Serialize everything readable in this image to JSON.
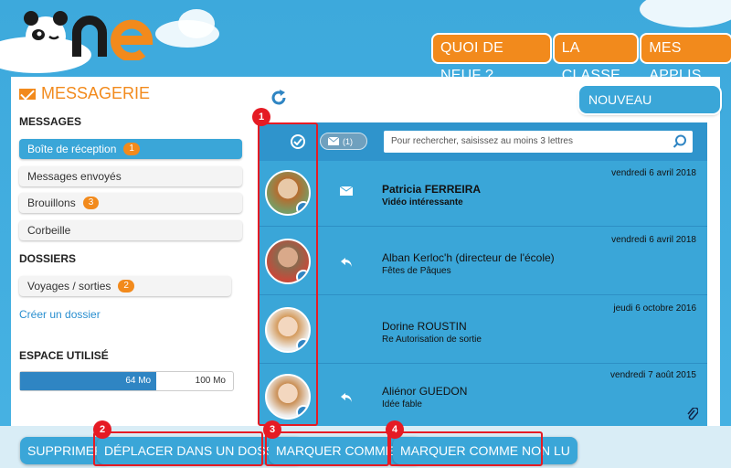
{
  "app": {
    "logo_text": "One"
  },
  "top_nav": [
    "QUOI DE NEUF ?",
    "LA CLASSE",
    "MES APPLIS"
  ],
  "page_title": "MESSAGERIE",
  "new_message_label": "NOUVEAU MESSAGE",
  "sidebar": {
    "messages_heading": "MESSAGES",
    "folders": [
      {
        "label": "Boîte de réception",
        "count": "1",
        "active": true
      },
      {
        "label": "Messages envoyés",
        "count": ""
      },
      {
        "label": "Brouillons",
        "count": "3"
      },
      {
        "label": "Corbeille",
        "count": ""
      }
    ],
    "dossiers_heading": "DOSSIERS",
    "dossiers": [
      {
        "label": "Voyages / sorties",
        "count": "2"
      }
    ],
    "create_folder_link": "Créer un dossier",
    "space_heading": "ESPACE UTILISÉ",
    "space_used": "64 Mo",
    "space_total": "100 Mo",
    "space_ratio": 0.64
  },
  "list_header": {
    "unread_count": "(1)",
    "search_placeholder": "Pour rechercher, saisissez au moins 3 lettres"
  },
  "messages": [
    {
      "date": "vendredi 6 avril 2018",
      "name": "Patricia FERREIRA",
      "subject": "Vidéo intéressante",
      "unread": true,
      "icon": "envelope-icon"
    },
    {
      "date": "vendredi 6 avril 2018",
      "name": "Alban Kerloc'h (directeur de l'école)",
      "subject": "Fêtes de Pâques",
      "unread": false,
      "icon": "reply-icon"
    },
    {
      "date": "jeudi 6 octobre 2016",
      "name": "Dorine ROUSTIN",
      "subject": "Re  Autorisation de sortie",
      "unread": false,
      "icon": ""
    },
    {
      "date": "vendredi 7 août 2015",
      "name": "Aliénor GUEDON",
      "subject": "Idée fable",
      "unread": false,
      "icon": "reply-icon",
      "attachment": true
    }
  ],
  "bottom_actions": [
    "SUPPRIMER",
    "DÉPLACER DANS UN DOSSIER",
    "MARQUER COMME LU",
    "MARQUER COMME NON LU"
  ],
  "annotations": [
    "1",
    "2",
    "3",
    "4"
  ],
  "colors": {
    "accent": "#f28a1c",
    "primary": "#3aa6d8",
    "annotation": "#e51b24"
  }
}
